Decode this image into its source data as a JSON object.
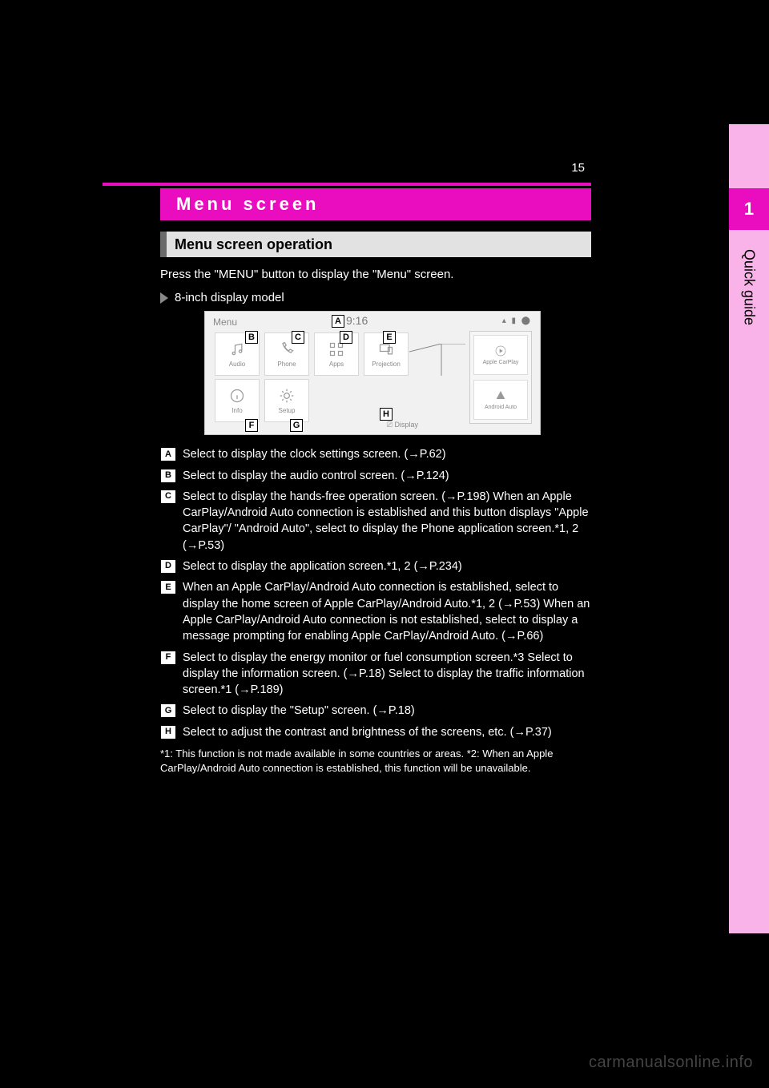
{
  "page_number": "15",
  "sidetab": {
    "chapter_number": "1",
    "chapter_title": "Quick guide"
  },
  "title": "Menu screen",
  "subhead": "Menu screen operation",
  "intro": "Press the \"MENU\" button to display the \"Menu\" screen.",
  "caption": "8-inch display model",
  "screenshot": {
    "menu_label": "Menu",
    "clock": "9:16",
    "tiles": {
      "audio": "Audio",
      "phone": "Phone",
      "apps": "Apps",
      "projection": "Projection",
      "info": "Info",
      "setup": "Setup"
    },
    "display_btn": "Display",
    "popout": {
      "carplay": "Apple CarPlay",
      "android": "Android Auto"
    },
    "markers": {
      "A": "A",
      "B": "B",
      "C": "C",
      "D": "D",
      "E": "E",
      "F": "F",
      "G": "G",
      "H": "H"
    }
  },
  "descriptions": [
    {
      "m": "A",
      "t": "Select to display the clock settings screen. (→P.62)"
    },
    {
      "m": "B",
      "t": "Select to display the audio control screen. (→P.124)"
    },
    {
      "m": "C",
      "t": "Select to display the hands-free operation screen. (→P.198)\nWhen an Apple CarPlay/Android Auto connection is established and this button displays \"Apple CarPlay\"/ \"Android Auto\", select to display the Phone application screen.*1, 2 (→P.53)"
    },
    {
      "m": "D",
      "t": "Select to display the application screen.*1, 2 (→P.234)"
    },
    {
      "m": "E",
      "t": "When an Apple CarPlay/Android Auto connection is established, select to display the home screen of Apple CarPlay/Android Auto.*1, 2 (→P.53)\nWhen an Apple CarPlay/Android Auto connection is not established, select to display a message prompting for enabling Apple CarPlay/Android Auto. (→P.66)"
    },
    {
      "m": "F",
      "t": "Select to display the energy monitor or fuel consumption screen.*3\nSelect to display the information screen. (→P.18)\nSelect to display the traffic information screen.*1 (→P.189)"
    },
    {
      "m": "G",
      "t": "Select to display the \"Setup\" screen. (→P.18)"
    },
    {
      "m": "H",
      "t": "Select to adjust the contrast and brightness of the screens, etc. (→P.37)"
    }
  ],
  "footnotes": "*1: This function is not made available in some countries or areas.\n*2: When an Apple CarPlay/Android Auto connection is established, this function will be unavailable.",
  "watermark": "carmanualsonline.info"
}
